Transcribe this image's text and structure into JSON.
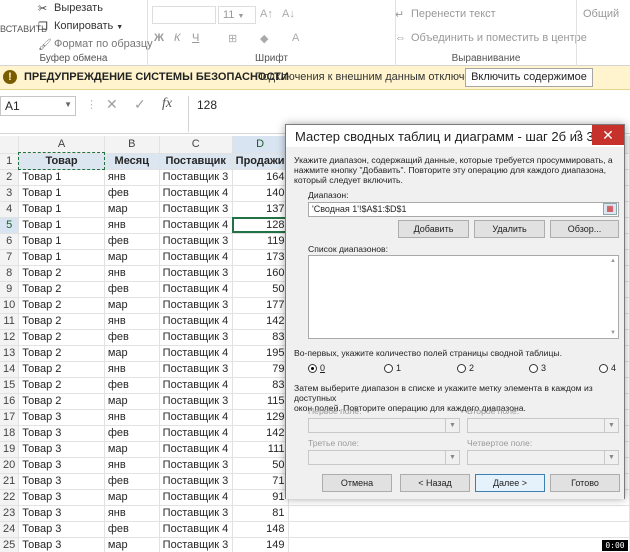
{
  "ribbon": {
    "clipboard_label": "Буфер обмена",
    "paste_label": "ВСТАВИТЬ",
    "cut_label": "Вырезать",
    "copy_label": "Копировать",
    "format_painter_label": "Формат по образцу",
    "font_label": "Шрифт",
    "font_size": "11",
    "bold": "Ж",
    "italic": "К",
    "underline": "Ч",
    "alignment_label": "Выравнивание",
    "wrap_text_label": "Перенести текст",
    "merge_label": "Объединить и поместить в центре",
    "number_format": "Общий"
  },
  "warning": {
    "icon": "!",
    "title": "ПРЕДУПРЕЖДЕНИЕ СИСТЕМЫ БЕЗОПАСНОСТИ",
    "message": "Подключения к внешним данным отключены",
    "button": "Включить содержимое"
  },
  "formula_bar": {
    "name_box": "A1",
    "cancel": "✕",
    "enter": "✓",
    "fx": "fx",
    "value": "128"
  },
  "sheet": {
    "columns": [
      "A",
      "B",
      "C",
      "D"
    ],
    "header": [
      "Товар",
      "Месяц",
      "Поставщик",
      "Продажи"
    ],
    "rows": [
      [
        "Товар 1",
        "янв",
        "Поставщик 3",
        "164"
      ],
      [
        "Товар 1",
        "фев",
        "Поставщик 4",
        "140"
      ],
      [
        "Товар 1",
        "мар",
        "Поставщик 3",
        "137"
      ],
      [
        "Товар 1",
        "янв",
        "Поставщик 4",
        "128"
      ],
      [
        "Товар 1",
        "фев",
        "Поставщик 3",
        "119"
      ],
      [
        "Товар 1",
        "мар",
        "Поставщик 4",
        "173"
      ],
      [
        "Товар 2",
        "янв",
        "Поставщик 3",
        "160"
      ],
      [
        "Товар 2",
        "фев",
        "Поставщик 4",
        "50"
      ],
      [
        "Товар 2",
        "мар",
        "Поставщик 3",
        "177"
      ],
      [
        "Товар 2",
        "янв",
        "Поставщик 4",
        "142"
      ],
      [
        "Товар 2",
        "фев",
        "Поставщик 3",
        "83"
      ],
      [
        "Товар 2",
        "мар",
        "Поставщик 4",
        "195"
      ],
      [
        "Товар 2",
        "янв",
        "Поставщик 3",
        "79"
      ],
      [
        "Товар 2",
        "фев",
        "Поставщик 4",
        "83"
      ],
      [
        "Товар 2",
        "мар",
        "Поставщик 3",
        "115"
      ],
      [
        "Товар 3",
        "янв",
        "Поставщик 4",
        "129"
      ],
      [
        "Товар 3",
        "фев",
        "Поставщик 4",
        "142"
      ],
      [
        "Товар 3",
        "мар",
        "Поставщик 4",
        "111"
      ],
      [
        "Товар 3",
        "янв",
        "Поставщик 3",
        "50"
      ],
      [
        "Товар 3",
        "фев",
        "Поставщик 3",
        "71"
      ],
      [
        "Товар 3",
        "мар",
        "Поставщик 4",
        "91"
      ],
      [
        "Товар 3",
        "янв",
        "Поставщик 3",
        "81"
      ],
      [
        "Товар 3",
        "фев",
        "Поставщик 4",
        "148"
      ],
      [
        "Товар 3",
        "мар",
        "Поставщик 3",
        "149"
      ]
    ]
  },
  "dialog": {
    "title": "Мастер сводных таблиц и диаграмм - шаг 2б из 3",
    "help": "?",
    "close": "✕",
    "instructions": [
      "Укажите диапазон, содержащий данные, которые требуется просуммировать, а",
      "нажмите кнопку \"Добавить\". Повторите эту операцию для каждого диапазона,",
      "который следует включить."
    ],
    "range_label": "Диапазон:",
    "range_value": "'Сводная 1'!$A$1:$D$1",
    "add_button": "Добавить",
    "delete_button": "Удалить",
    "browse_button": "Обзор...",
    "ranges_list_label": "Список диапазонов:",
    "page_fields_label": "Во-первых, укажите количество полей страницы сводной таблицы.",
    "radio_options": [
      "0",
      "1",
      "2",
      "3",
      "4"
    ],
    "radio_selected": "0",
    "select_range_text": [
      "Затем выберите диапазон в списке и укажите метку элемента в каждом из доступных",
      "окон полей. Повторите операцию для каждого диапазона."
    ],
    "field1_label": "Первое поле:",
    "field2_label": "Второе поле:",
    "field3_label": "Третье поле:",
    "field4_label": "Четвертое поле:",
    "cancel_button": "Отмена",
    "back_button": "< Назад",
    "next_button": "Далее >",
    "finish_button": "Готово"
  },
  "recorder": "0:00"
}
